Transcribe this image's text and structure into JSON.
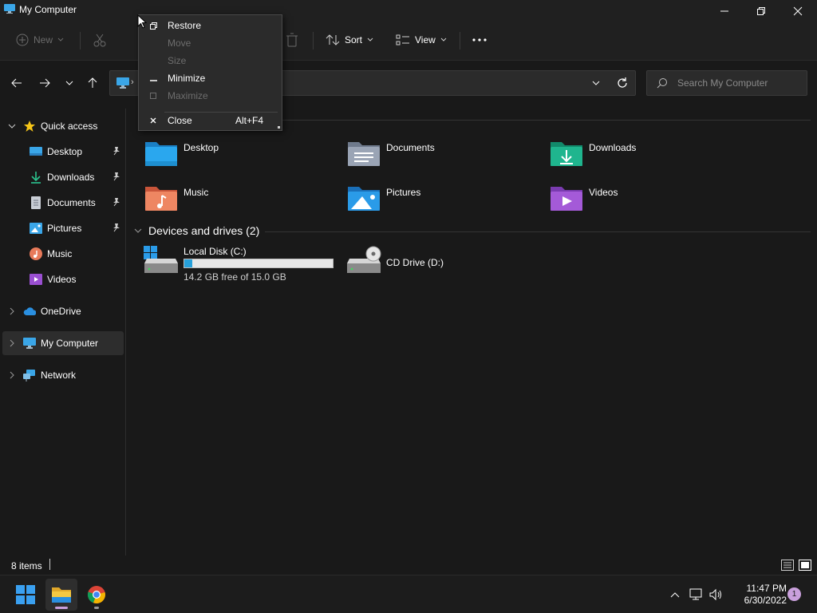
{
  "window": {
    "title": "My Computer"
  },
  "toolbar": {
    "new_label": "New",
    "sort_label": "Sort",
    "view_label": "View"
  },
  "search": {
    "placeholder": "Search My Computer"
  },
  "sidebar": {
    "items": [
      {
        "label": "Quick access",
        "icon": "star-icon"
      },
      {
        "label": "Desktop",
        "icon": "desktop-icon",
        "pinned": true
      },
      {
        "label": "Downloads",
        "icon": "download-icon",
        "pinned": true
      },
      {
        "label": "Documents",
        "icon": "documents-icon",
        "pinned": true
      },
      {
        "label": "Pictures",
        "icon": "pictures-icon",
        "pinned": true
      },
      {
        "label": "Music",
        "icon": "music-icon"
      },
      {
        "label": "Videos",
        "icon": "videos-icon"
      },
      {
        "label": "OneDrive",
        "icon": "cloud-icon"
      },
      {
        "label": "My Computer",
        "icon": "computer-icon",
        "selected": true
      },
      {
        "label": "Network",
        "icon": "network-icon"
      }
    ]
  },
  "folders": [
    {
      "label": "Desktop",
      "color": "#1e9be0"
    },
    {
      "label": "Documents",
      "color": "#8f9bae"
    },
    {
      "label": "Downloads",
      "color": "#1fb58e"
    },
    {
      "label": "Music",
      "color": "#e8714e"
    },
    {
      "label": "Pictures",
      "color": "#2a8fe0"
    },
    {
      "label": "Videos",
      "color": "#9a4fd1"
    }
  ],
  "devices": {
    "heading": "Devices and drives (2)",
    "drives": [
      {
        "label": "Local Disk (C:)",
        "free_text": "14.2 GB free of 15.0 GB",
        "used_fraction": 0.053
      },
      {
        "label": "CD Drive (D:)"
      }
    ]
  },
  "status": {
    "items_count": "8 items"
  },
  "taskbar": {
    "time": "11:47 PM",
    "date": "6/30/2022",
    "notification_count": "1"
  },
  "context_menu": {
    "items": [
      {
        "label": "Restore",
        "enabled": true
      },
      {
        "label": "Move",
        "enabled": false
      },
      {
        "label": "Size",
        "enabled": false
      },
      {
        "label": "Minimize",
        "enabled": true
      },
      {
        "label": "Maximize",
        "enabled": false
      },
      {
        "label": "Close",
        "enabled": true,
        "shortcut": "Alt+F4"
      }
    ]
  },
  "colors": {
    "accent": "#26a0da",
    "background": "#191919",
    "chrome": "#202020"
  }
}
